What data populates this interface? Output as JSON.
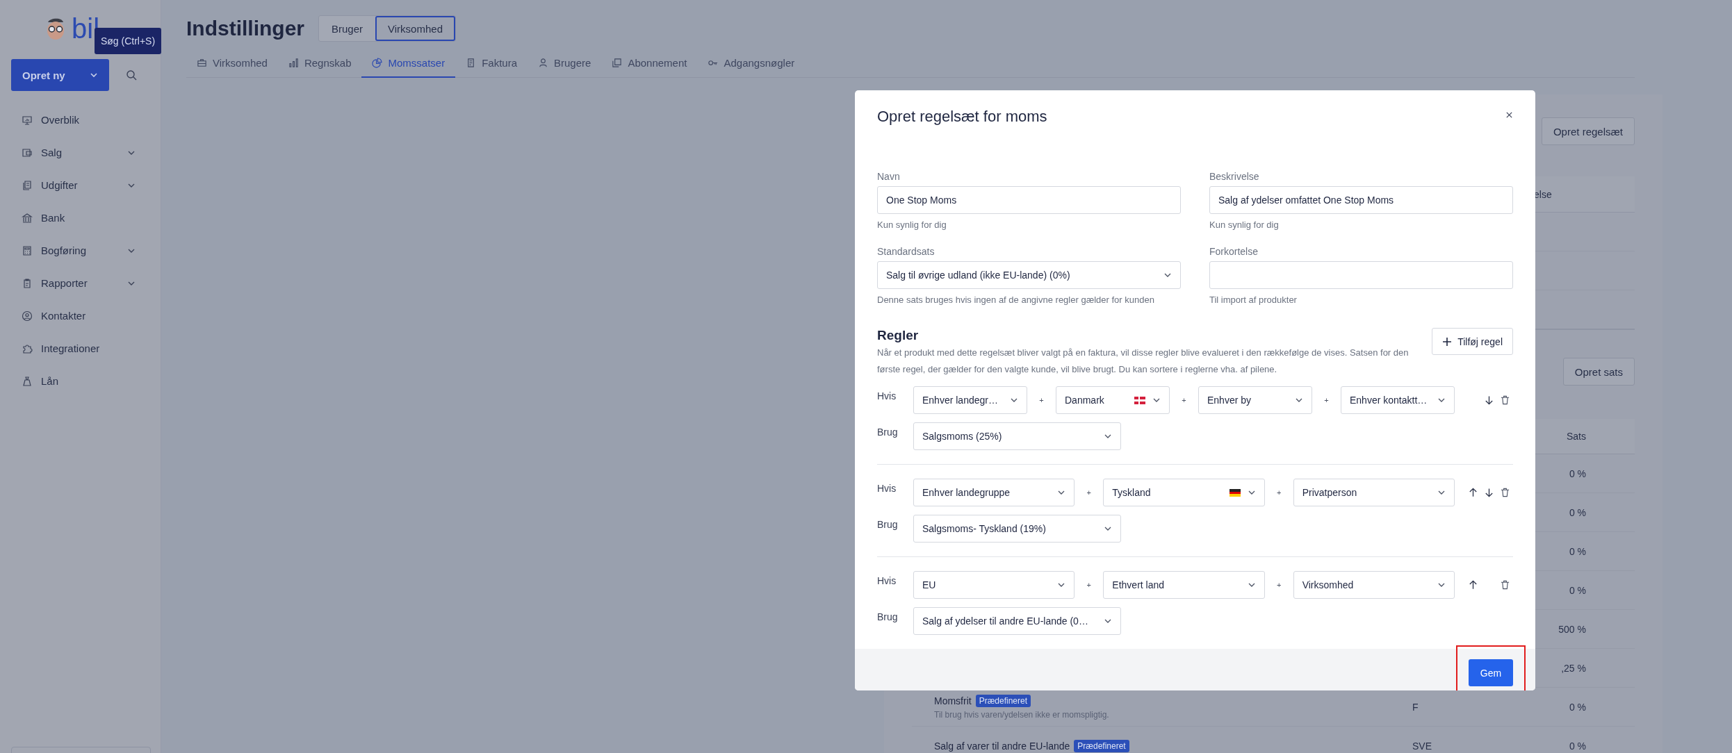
{
  "sidebar": {
    "logo_text": "bil",
    "tooltip": "Søg (Ctrl+S)",
    "create_button": "Opret ny",
    "nav": [
      {
        "label": "Overblik",
        "expandable": false
      },
      {
        "label": "Salg",
        "expandable": true
      },
      {
        "label": "Udgifter",
        "expandable": true
      },
      {
        "label": "Bank",
        "expandable": false
      },
      {
        "label": "Bogføring",
        "expandable": true
      },
      {
        "label": "Rapporter",
        "expandable": true
      },
      {
        "label": "Kontakter",
        "expandable": false
      },
      {
        "label": "Integrationer",
        "expandable": false
      },
      {
        "label": "Lån",
        "expandable": false
      }
    ]
  },
  "header": {
    "title": "Indstillinger",
    "scopes": [
      {
        "label": "Bruger",
        "selected": false
      },
      {
        "label": "Virksomhed",
        "selected": true
      }
    ]
  },
  "tabs": [
    {
      "label": "Virksomhed",
      "selected": false
    },
    {
      "label": "Regnskab",
      "selected": false
    },
    {
      "label": "Momssatser",
      "selected": true
    },
    {
      "label": "Faktura",
      "selected": false
    },
    {
      "label": "Brugere",
      "selected": false
    },
    {
      "label": "Abonnement",
      "selected": false
    },
    {
      "label": "Adgangsnøgler",
      "selected": false
    }
  ],
  "rulesets": {
    "create_button": "Opret regelsæt",
    "column_header": "else"
  },
  "rates": {
    "create_button": "Opret sats",
    "column_header": "Sats",
    "rows": [
      {
        "rate": "0 %"
      },
      {
        "rate": "0 %"
      },
      {
        "rate": "0 %"
      },
      {
        "rate": "0 %"
      },
      {
        "rate": "500 %"
      },
      {
        "rate": ",25 %"
      },
      {
        "name": "Momsfrit",
        "badge": "Prædefineret",
        "description": "Til brug hvis varen/ydelsen ikke er momspligtig.",
        "code": "F",
        "rate": "0 %"
      },
      {
        "name": "Salg af varer til andre EU-lande",
        "badge": "Prædefineret",
        "code": "SVE",
        "rate": "0 %"
      }
    ]
  },
  "modal": {
    "title": "Opret regelsæt for moms",
    "fields": [
      {
        "label": "Navn",
        "kind": "text",
        "value": "One Stop Moms",
        "help": "Kun synlig for dig"
      },
      {
        "label": "Beskrivelse",
        "kind": "text",
        "value": "Salg af ydelser omfattet One Stop Moms",
        "help": "Kun synlig for dig"
      },
      {
        "label": "Standardsats",
        "kind": "select",
        "value": "Salg til øvrige udland (ikke EU-lande) (0%)",
        "help": "Denne sats bruges hvis ingen af de angivne regler gælder for kunden"
      },
      {
        "label": "Forkortelse",
        "kind": "text",
        "help": "Til import af produkter"
      }
    ],
    "rules_heading": "Regler",
    "rules_description": "Når et produkt med dette regelsæt bliver valgt på en faktura, vil disse regler blive evalueret i den rækkefølge de vises. Satsen for den første regel, der gælder for den valgte kunde, vil blive brugt. Du kan sortere i reglerne vha. af pilene.",
    "add_rule_button": "Tilføj regel",
    "rules": [
      {
        "if_label": "Hvis",
        "conditions": [
          {
            "value": "Enhver landegr…"
          },
          {
            "joiner": "+",
            "value": "Danmark",
            "kind": "danish-flag"
          },
          {
            "joiner": "+",
            "value": "Enhver by"
          },
          {
            "joiner": "+",
            "value": "Enhver kontaktt…"
          }
        ],
        "use_label": "Brug",
        "use": "Salgsmoms (25%)",
        "can_move_up": false,
        "can_move_down": true
      },
      {
        "if_label": "Hvis",
        "conditions": [
          {
            "value": "Enhver landegruppe"
          },
          {
            "joiner": "+",
            "value": "Tyskland",
            "kind": "german-flag"
          },
          {
            "joiner": "+",
            "value": "Privatperson"
          }
        ],
        "use_label": "Brug",
        "use": "Salgsmoms- Tyskland (19%)",
        "can_move_up": true,
        "can_move_down": true
      },
      {
        "if_label": "Hvis",
        "conditions": [
          {
            "value": "EU"
          },
          {
            "joiner": "+",
            "value": "Ethvert land"
          },
          {
            "joiner": "+",
            "value": "Virksomhed"
          }
        ],
        "use_label": "Brug",
        "use": "Salg af ydelser til andre EU-lande (0…",
        "can_move_up": true,
        "can_move_down": false
      }
    ],
    "save_button": "Gem",
    "save_highlighted": true
  }
}
